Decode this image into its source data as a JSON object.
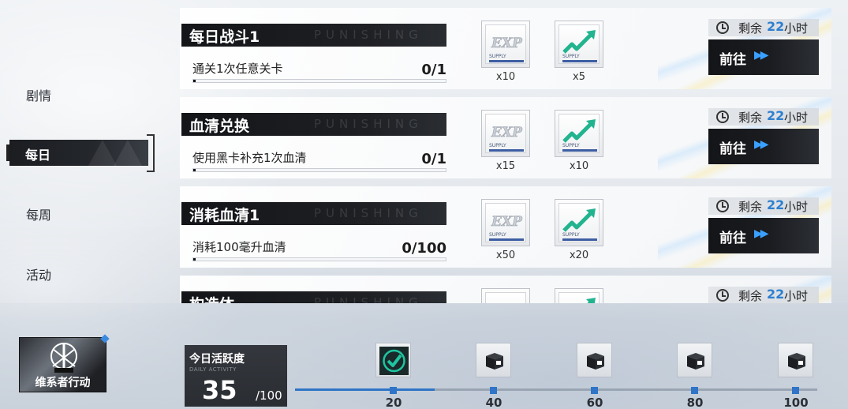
{
  "nav": {
    "items": [
      {
        "label": "剧情"
      },
      {
        "label": "每日"
      },
      {
        "label": "每周"
      },
      {
        "label": "活动"
      }
    ],
    "active_index": 1
  },
  "tasks": [
    {
      "title": "每日战斗1",
      "watermark": "PUNISHING",
      "desc": "通关1次任意关卡",
      "progress": "0/1",
      "rewards": [
        {
          "icon": "exp-supply-icon",
          "count": "x10"
        },
        {
          "icon": "level-up-arrow-icon",
          "count": "x5"
        }
      ],
      "timer": {
        "label": "剩余",
        "value": "22",
        "unit": "小时"
      },
      "go_label": "前往"
    },
    {
      "title": "血清兑换",
      "watermark": "PUNISHING",
      "desc": "使用黑卡补充1次血清",
      "progress": "0/1",
      "rewards": [
        {
          "icon": "exp-supply-icon",
          "count": "x15"
        },
        {
          "icon": "level-up-arrow-icon",
          "count": "x10"
        }
      ],
      "timer": {
        "label": "剩余",
        "value": "22",
        "unit": "小时"
      },
      "go_label": "前往"
    },
    {
      "title": "消耗血清1",
      "watermark": "PUNISHING",
      "desc": "消耗100毫升血清",
      "progress": "0/100",
      "rewards": [
        {
          "icon": "exp-supply-icon",
          "count": "x50"
        },
        {
          "icon": "level-up-arrow-icon",
          "count": "x20"
        }
      ],
      "timer": {
        "label": "剩余",
        "value": "22",
        "unit": "小时"
      },
      "go_label": "前往"
    },
    {
      "title": "构造体",
      "watermark": "PUNISHING",
      "desc": "",
      "progress": "",
      "rewards": [
        {
          "icon": "exp-supply-icon",
          "count": ""
        },
        {
          "icon": "level-up-arrow-icon",
          "count": ""
        }
      ],
      "timer": {
        "label": "剩余",
        "value": "22",
        "unit": "小时"
      },
      "go_label": ""
    }
  ],
  "event": {
    "label": "维系者行动"
  },
  "activity": {
    "title": "今日活跃度",
    "subtitle": "DAILY ACTIVITY",
    "value": "35",
    "max": "/100",
    "progress_fraction": 0.35
  },
  "milestones": [
    {
      "value": "20",
      "claimed": true
    },
    {
      "value": "40",
      "claimed": false
    },
    {
      "value": "60",
      "claimed": false
    },
    {
      "value": "80",
      "claimed": false
    },
    {
      "value": "100",
      "claimed": false
    }
  ],
  "colors": {
    "accent": "#2f74c6",
    "timer_number": "#2d7fd0",
    "dark_panel": "#1a1c20",
    "check_green": "#1fc4a0"
  }
}
